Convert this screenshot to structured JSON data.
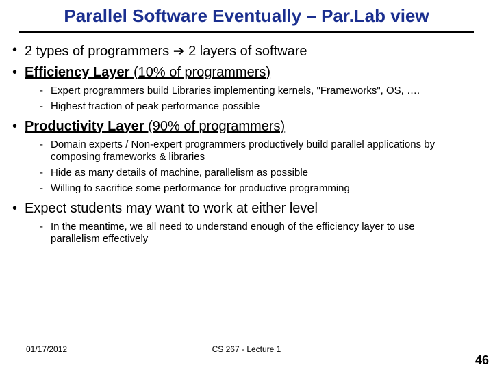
{
  "title": "Parallel Software Eventually – Par.Lab view",
  "bullets": {
    "b0": {
      "pre": "2 types of programmers ",
      "arrow": "➔",
      "post": " 2 layers of software"
    },
    "b1": {
      "bold": "Efficiency Layer",
      "rest": " (10% of programmers)"
    },
    "b1s": [
      "Expert programmers build Libraries implementing kernels, \"Frameworks\", OS, ….",
      "Highest fraction of peak performance possible"
    ],
    "b2": {
      "bold": "Productivity Layer",
      "rest": " (90% of programmers)"
    },
    "b2s": [
      "Domain experts / Non-expert programmers productively build parallel applications by composing frameworks & libraries",
      "Hide as many details of machine, parallelism as possible",
      "Willing to sacrifice some performance for productive programming"
    ],
    "b3": "Expect students may want to work at either level",
    "b3s": [
      "In the meantime, we all need to understand enough of the efficiency layer to use parallelism effectively"
    ]
  },
  "footer": {
    "date": "01/17/2012",
    "center": "CS 267 - Lecture 1",
    "page": "46"
  }
}
